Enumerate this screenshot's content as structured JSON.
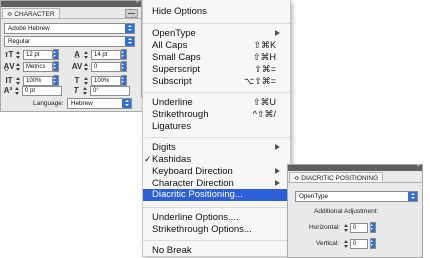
{
  "character_panel": {
    "tab_label": "≎ CHARACTER",
    "font_family": "Adobe Hebrew",
    "font_style": "Regular",
    "font_size": "12 pt",
    "leading": "14 pt",
    "kerning": "Metrics",
    "tracking": "0",
    "vertical_scale": "100%",
    "horizontal_scale": "100%",
    "baseline_shift": "0 pt",
    "skew": "0°",
    "language_label": "Language:",
    "language_value": "Hebrew"
  },
  "context_menu": {
    "items": [
      {
        "label": "Hide Options"
      },
      {
        "label": "OpenType"
      },
      {
        "label": "All Caps",
        "shortcut": "⇧⌘K"
      },
      {
        "label": "Small Caps",
        "shortcut": "⇧⌘H"
      },
      {
        "label": "Superscript",
        "shortcut": "⇧⌘="
      },
      {
        "label": "Subscript",
        "shortcut": "⌥⇧⌘="
      },
      {
        "label": "Underline",
        "shortcut": "⇧⌘U"
      },
      {
        "label": "Strikethrough",
        "shortcut": "^⇧⌘/"
      },
      {
        "label": "Ligatures"
      },
      {
        "label": "Digits"
      },
      {
        "label": "Kashidas",
        "checkmark": "✓"
      },
      {
        "label": "Keyboard Direction"
      },
      {
        "label": "Character Direction"
      },
      {
        "label": "Diacritic Positioning..."
      },
      {
        "label": "Underline Options...."
      },
      {
        "label": "Strikethrough Options..."
      },
      {
        "label": "No Break"
      }
    ]
  },
  "diacritic_panel": {
    "tab_label": "≎ DIACRITIC POSITIONING",
    "mode": "OpenType",
    "adjustment_label": "Additional Adjustment:",
    "horizontal_label": "Horizontal:",
    "horizontal_value": "0",
    "vertical_label": "Vertical:",
    "vertical_value": "0"
  },
  "colors": {
    "highlight": "#2d5fd8",
    "panel_bg": "#e9e9e9",
    "menu_bg": "#f7f7f7"
  }
}
